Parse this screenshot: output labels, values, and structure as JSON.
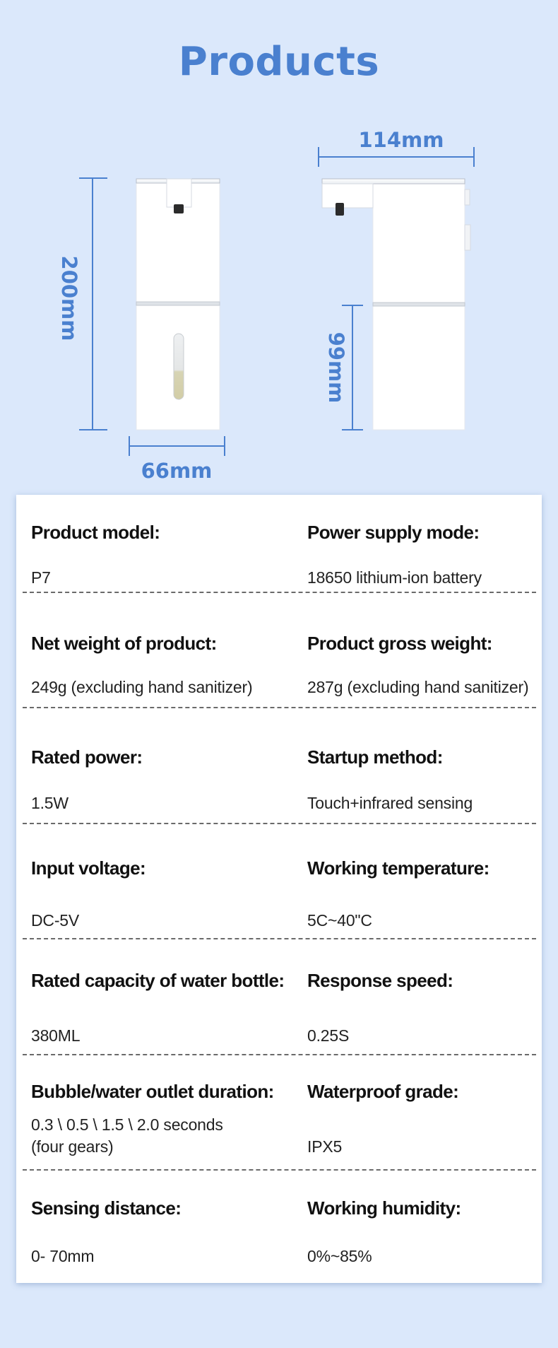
{
  "title": "Products",
  "dimensions": {
    "height": "200mm",
    "base_width": "66mm",
    "depth": "114mm",
    "lower_height": "99mm"
  },
  "colors": {
    "background": "#dbe8fb",
    "accent": "#4a80cf",
    "card": "#ffffff"
  },
  "specs": [
    {
      "left": {
        "label": "Product model:",
        "value": "P7"
      },
      "right": {
        "label": "Power supply mode:",
        "value": "18650 lithium-ion battery"
      }
    },
    {
      "left": {
        "label": "Net weight of product:",
        "value": "249g (excluding hand sanitizer)"
      },
      "right": {
        "label": "Product gross weight:",
        "value": "287g (excluding hand sanitizer)"
      }
    },
    {
      "left": {
        "label": "Rated power:",
        "value": "1.5W"
      },
      "right": {
        "label": "Startup method:",
        "value": "Touch+infrared sensing"
      }
    },
    {
      "left": {
        "label": "Input voltage:",
        "value": "DC-5V"
      },
      "right": {
        "label": "Working temperature:",
        "value": "5C~40\"C"
      }
    },
    {
      "left": {
        "label": "Rated capacity of water bottle:",
        "value": "380ML"
      },
      "right": {
        "label": "Response speed:",
        "value": "0.25S"
      }
    },
    {
      "left": {
        "label": "Bubble/water outlet duration:",
        "value": "0.3 \\ 0.5 \\ 1.5 \\ 2.0 seconds\n(four gears)"
      },
      "right": {
        "label": "Waterproof grade:",
        "value": "IPX5"
      }
    },
    {
      "left": {
        "label": "Sensing distance:",
        "value": "0- 70mm"
      },
      "right": {
        "label": "Working humidity:",
        "value": "0%~85%"
      }
    }
  ]
}
